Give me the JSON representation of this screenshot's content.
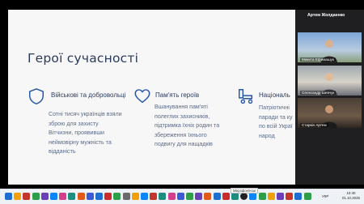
{
  "slide": {
    "title": "Герої сучасності",
    "cards": [
      {
        "heading": "Військові та добровольці",
        "icon": "shield-icon",
        "lines": [
          "Сотні тисяч українців взяли",
          "зброю для захисту",
          "Вітчизни, проявивши",
          "неймовірну мужність та",
          "відданість"
        ]
      },
      {
        "heading": "Пам'ять героїв",
        "icon": "heart-icon",
        "lines": [
          "Вшанування пам'яті",
          "полеглих захисників,",
          "підтримка їхніх родин та",
          "збереження їхнього",
          "подвигу для нащадків"
        ]
      },
      {
        "heading": "Національ",
        "icon": "wheelchair-icon",
        "lines": [
          "Патріотичні",
          "паради та ку",
          "по всій Украї",
          "народ"
        ]
      }
    ]
  },
  "video_call": {
    "presenter": "Артем Жолдаенко",
    "participants": [
      {
        "name": "Микита Ефимашук"
      },
      {
        "name": "Олександр Шевчук"
      },
      {
        "name": "Старкін Артем"
      }
    ]
  },
  "taskbar": {
    "tooltip": "Мікрофон/нош",
    "lang": "УКР",
    "time": "10:40",
    "date": "01.10.2025",
    "icon_colors": [
      "#1f6fd1",
      "#f2a007",
      "#c3362b",
      "#2e9e4a",
      "#6b3fb8",
      "#0a84ff",
      "#d43f8d",
      "#1e8c7e",
      "#e05a1b",
      "#3b5bd6",
      "#1f6fd1",
      "#cc2b2b",
      "#2e9e4a",
      "#6b6b6b",
      "#f2a007",
      "#0a84ff",
      "#c3362b",
      "#1e8c7e",
      "#d43f8d",
      "#3b5bd6",
      "#2e9e4a",
      "#6b3fb8",
      "#e05a1b",
      "#1f6fd1",
      "#cc2b2b",
      "#1e8c7e",
      "#222222",
      "#0a84ff",
      "#2e9e4a",
      "#f2a007",
      "#6b3fb8",
      "#c3362b",
      "#1f6fd1",
      "#2e9e4a"
    ]
  }
}
